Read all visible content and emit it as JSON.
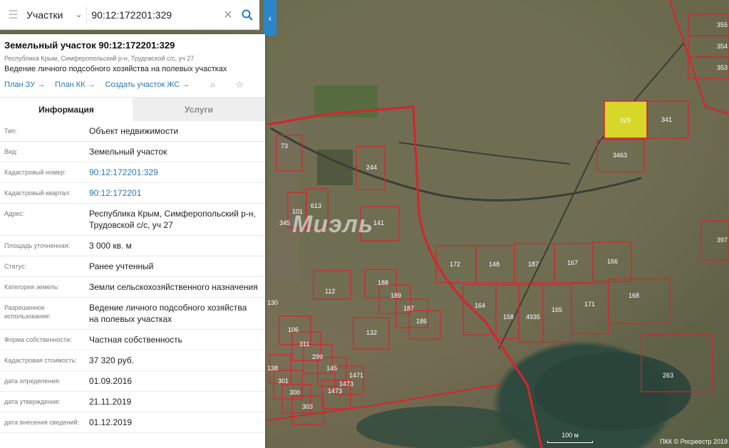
{
  "search": {
    "category": "Участки",
    "query": "90:12:172201:329"
  },
  "panel": {
    "title": "Земельный участок 90:12:172201:329",
    "address_short": "Республика Крым, Симферопольский р-н, Трудовской с/с, уч 27",
    "usage": "Ведение личного подсобного хозяйства на полевых участках",
    "links": [
      "План ЗУ →",
      "План КК →",
      "Создать участок ЖС →"
    ],
    "tabs": [
      "Информация",
      "Услуги"
    ],
    "rows": [
      {
        "label": "Тип:",
        "value": "Объект недвижимости"
      },
      {
        "label": "Вид:",
        "value": "Земельный участок"
      },
      {
        "label": "Кадастровый номер:",
        "value": "90:12:172201:329"
      },
      {
        "label": "Кадастровый квартал:",
        "value": "90:12:172201"
      },
      {
        "label": "Адрес:",
        "value": "Республика Крым, Симферопольский р-н, Трудовской с/с, уч 27"
      },
      {
        "label": "Площадь уточненная:",
        "value": "3 000 кв. м"
      },
      {
        "label": "Статус:",
        "value": "Ранее учтенный"
      },
      {
        "label": "Категория земель:",
        "value": "Земли сельскохозяйственного назначения"
      },
      {
        "label": "Разрешенное использование:",
        "value": "Ведение личного подсобного хозяйства на полевых участках"
      },
      {
        "label": "Форма собственности:",
        "value": "Частная собственность"
      },
      {
        "label": "Кадастровая стоимость:",
        "value": "37 320 руб."
      },
      {
        "label": "дата определения:",
        "value": "01.09.2016"
      },
      {
        "label": "дата утверждения:",
        "value": "21.11.2019"
      },
      {
        "label": "дата внесения сведений:",
        "value": "01.12.2019"
      }
    ]
  },
  "map": {
    "watermark": "Миэль",
    "scale": "100 м",
    "attribution": "ПКК © Росреестр 2019",
    "plots": [
      "329",
      "341",
      "3463",
      "73",
      "244",
      "613",
      "345",
      "141",
      "172",
      "148",
      "187",
      "167",
      "166",
      "164",
      "158",
      "4935",
      "165",
      "171",
      "168",
      "112",
      "188",
      "189",
      "187",
      "186",
      "132",
      "106",
      "311",
      "299",
      "145",
      "1471",
      "1473",
      "138",
      "301",
      "300",
      "303",
      "263",
      "397",
      "355",
      "354",
      "353",
      "130"
    ],
    "highlight_color": "#d7d72a"
  }
}
